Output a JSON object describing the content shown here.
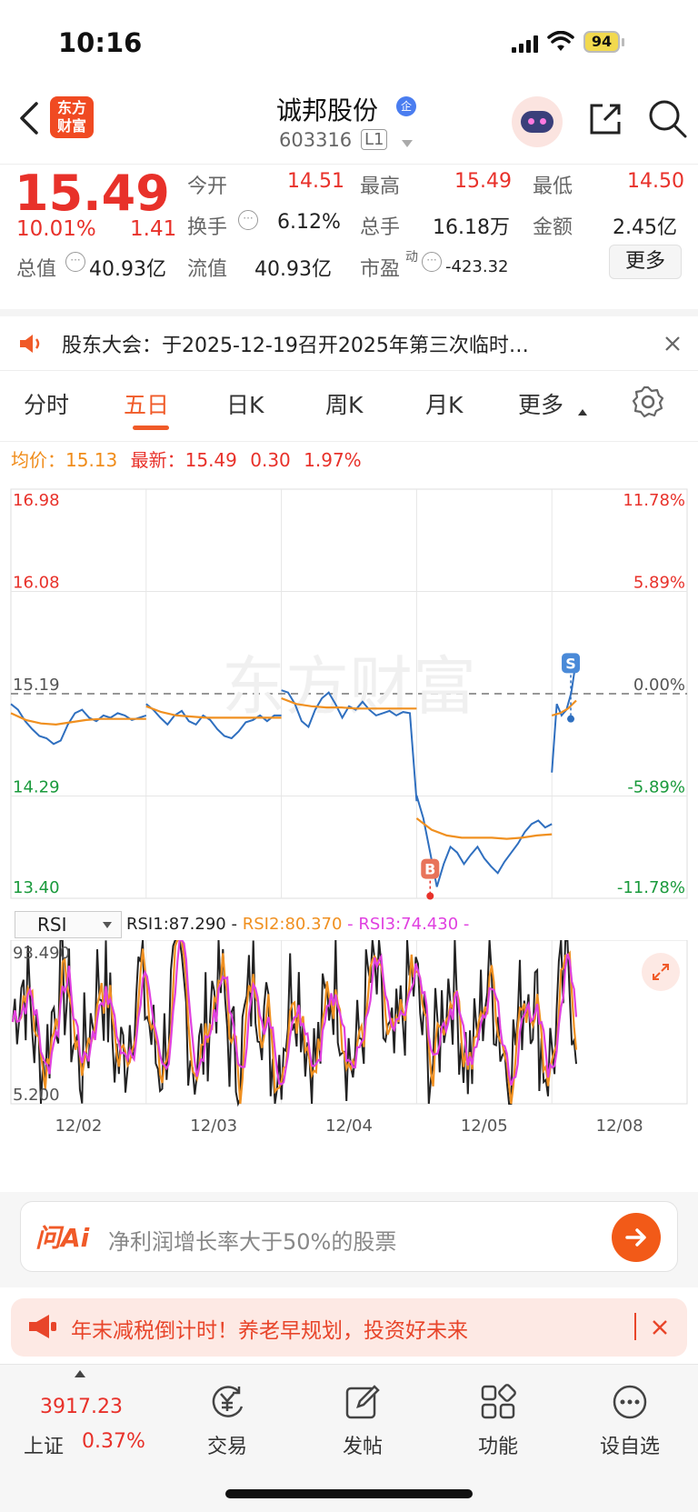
{
  "status": {
    "time": "10:16",
    "battery": "94"
  },
  "header": {
    "app_logo_line1": "东方",
    "app_logo_line2": "财富",
    "stock_name": "诚邦股份",
    "badge": "企",
    "stock_code": "603316",
    "level": "L1"
  },
  "quote": {
    "price": "15.49",
    "change_pct": "10.01%",
    "change_amt": "1.41",
    "open_label": "今开",
    "open": "14.51",
    "high_label": "最高",
    "high": "15.49",
    "low_label": "最低",
    "low": "14.50",
    "turnover_label": "换手",
    "turnover": "6.12%",
    "volume_label": "总手",
    "volume": "16.18万",
    "amount_label": "金额",
    "amount": "2.45亿",
    "mktcap_label": "总值",
    "mktcap": "40.93亿",
    "float_label": "流值",
    "float": "40.93亿",
    "pe_label": "市盈",
    "pe_sup": "动",
    "pe": "-423.32",
    "more_button": "更多"
  },
  "notice": {
    "text": "股东大会：于2025-12-19召开2025年第三次临时…"
  },
  "tabs": [
    {
      "label": "分时"
    },
    {
      "label": "五日"
    },
    {
      "label": "日K"
    },
    {
      "label": "周K"
    },
    {
      "label": "月K"
    },
    {
      "label": "更多"
    }
  ],
  "info_line": {
    "avg_label": "均价：",
    "avg": "15.13",
    "latest_label": "最新：",
    "latest": "15.49",
    "chg": "0.30",
    "chg_pct": "1.97%"
  },
  "chart_data": {
    "type": "line",
    "y_left_ticks": [
      "16.98",
      "16.08",
      "15.19",
      "14.29",
      "13.40"
    ],
    "y_right_ticks": [
      "11.78%",
      "5.89%",
      "0.00%",
      "-5.89%",
      "-11.78%"
    ],
    "ylim": [
      13.4,
      16.98
    ],
    "prev_close": 15.19,
    "x_labels": [
      "12/02",
      "12/03",
      "12/04",
      "12/05",
      "12/08"
    ],
    "series": [
      {
        "color": "#2f6fbf",
        "segments": [
          [
            15.1,
            15.05,
            14.95,
            14.88,
            14.82,
            14.8,
            14.75,
            14.78,
            14.92,
            15.02,
            15.05,
            14.98,
            14.95,
            15.0,
            14.98,
            15.02,
            15.0,
            14.96,
            14.98,
            15.0
          ],
          [
            15.1,
            15.05,
            14.98,
            14.92,
            15.0,
            15.04,
            14.95,
            14.92,
            15.0,
            14.96,
            14.88,
            14.82,
            14.8,
            14.86,
            14.94,
            14.96,
            15.0,
            14.95,
            15.0,
            15.0
          ],
          [
            15.22,
            15.2,
            15.1,
            14.95,
            14.9,
            15.05,
            15.15,
            15.2,
            15.1,
            14.98,
            15.08,
            15.05,
            15.12,
            15.05,
            15.0,
            15.02,
            15.04,
            15.0,
            15.03,
            15.02,
            14.25
          ],
          [
            14.3,
            14.1,
            13.8,
            13.5,
            13.7,
            13.85,
            13.8,
            13.7,
            13.78,
            13.85,
            13.75,
            13.68,
            13.62,
            13.72,
            13.8,
            13.88,
            13.98,
            14.05,
            14.08,
            14.02,
            14.05
          ],
          [
            14.5,
            15.1,
            15.0,
            15.05,
            15.2,
            15.49
          ]
        ]
      },
      {
        "color": "#f09020",
        "segments": [
          [
            15.02,
            14.96,
            14.93,
            14.92,
            14.94,
            14.96,
            14.97,
            14.97,
            14.97,
            14.97
          ],
          [
            15.08,
            15.03,
            15.0,
            14.99,
            14.98,
            14.98,
            14.98,
            14.98,
            14.98,
            14.98
          ],
          [
            15.15,
            15.1,
            15.08,
            15.07,
            15.07,
            15.06,
            15.06,
            15.06,
            15.06,
            15.06
          ],
          [
            14.1,
            14.0,
            13.95,
            13.93,
            13.93,
            13.93,
            13.92,
            13.93,
            13.95,
            13.96
          ],
          [
            15.0,
            15.02,
            15.06,
            15.13
          ]
        ]
      }
    ],
    "markers": [
      "B",
      "S"
    ],
    "watermark": "东方财富"
  },
  "rsi": {
    "select_label": "RSI",
    "rsi1_label": "RSI1:87.290",
    "rsi2_label": "RSI2:80.370",
    "rsi3_label": "RSI3:74.430",
    "top_tick": "93.490",
    "bottom_tick": "5.200",
    "colors": {
      "rsi1": "#222222",
      "rsi2": "#f09020",
      "rsi3": "#e040e0"
    }
  },
  "ai_bar": {
    "logo": "问Ai",
    "placeholder": "净利润增长率大于50%的股票"
  },
  "promo": {
    "text": "年末减税倒计时！养老早规划，投资好未来"
  },
  "bottom_nav": {
    "index_value": "3917.23",
    "index_name": "上证",
    "index_change": "0.37%",
    "items": [
      {
        "label": "交易"
      },
      {
        "label": "发帖"
      },
      {
        "label": "功能"
      },
      {
        "label": "设自选"
      }
    ]
  }
}
